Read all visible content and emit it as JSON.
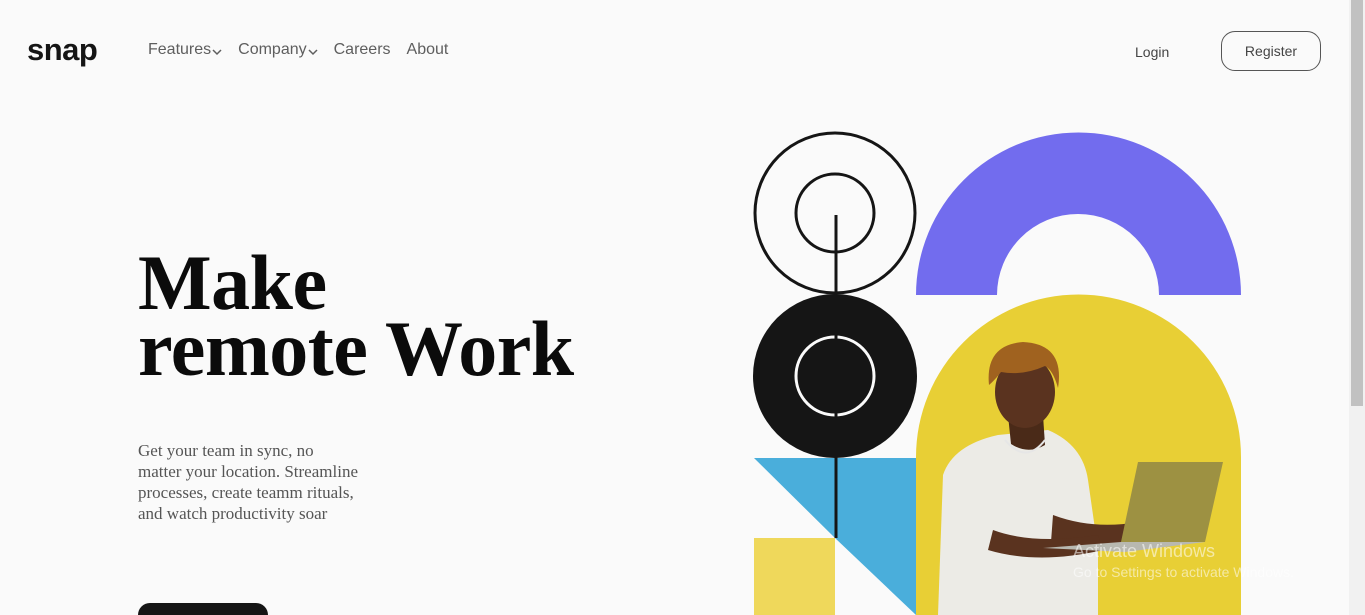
{
  "brand": {
    "logo_text": "snap"
  },
  "nav": {
    "items": [
      {
        "label": "Features",
        "has_dropdown": true
      },
      {
        "label": "Company",
        "has_dropdown": true
      },
      {
        "label": "Careers",
        "has_dropdown": false
      },
      {
        "label": "About",
        "has_dropdown": false
      }
    ]
  },
  "auth": {
    "login_label": "Login",
    "register_label": "Register"
  },
  "hero": {
    "headline_line1": "Make",
    "headline_line2": "remote Work",
    "subtext": "Get your team in sync, no matter your location. Streamline processes, create teamm rituals, and watch productivity soar"
  },
  "colors": {
    "purple": "#726cee",
    "yellow": "#e8cf35",
    "blue": "#4aaedb",
    "pale_yellow": "#efd85b",
    "dark": "#151515",
    "background": "#fafafa"
  },
  "watermark": {
    "line1": "Activate Windows",
    "line2": "Go to Settings to activate Windows."
  }
}
